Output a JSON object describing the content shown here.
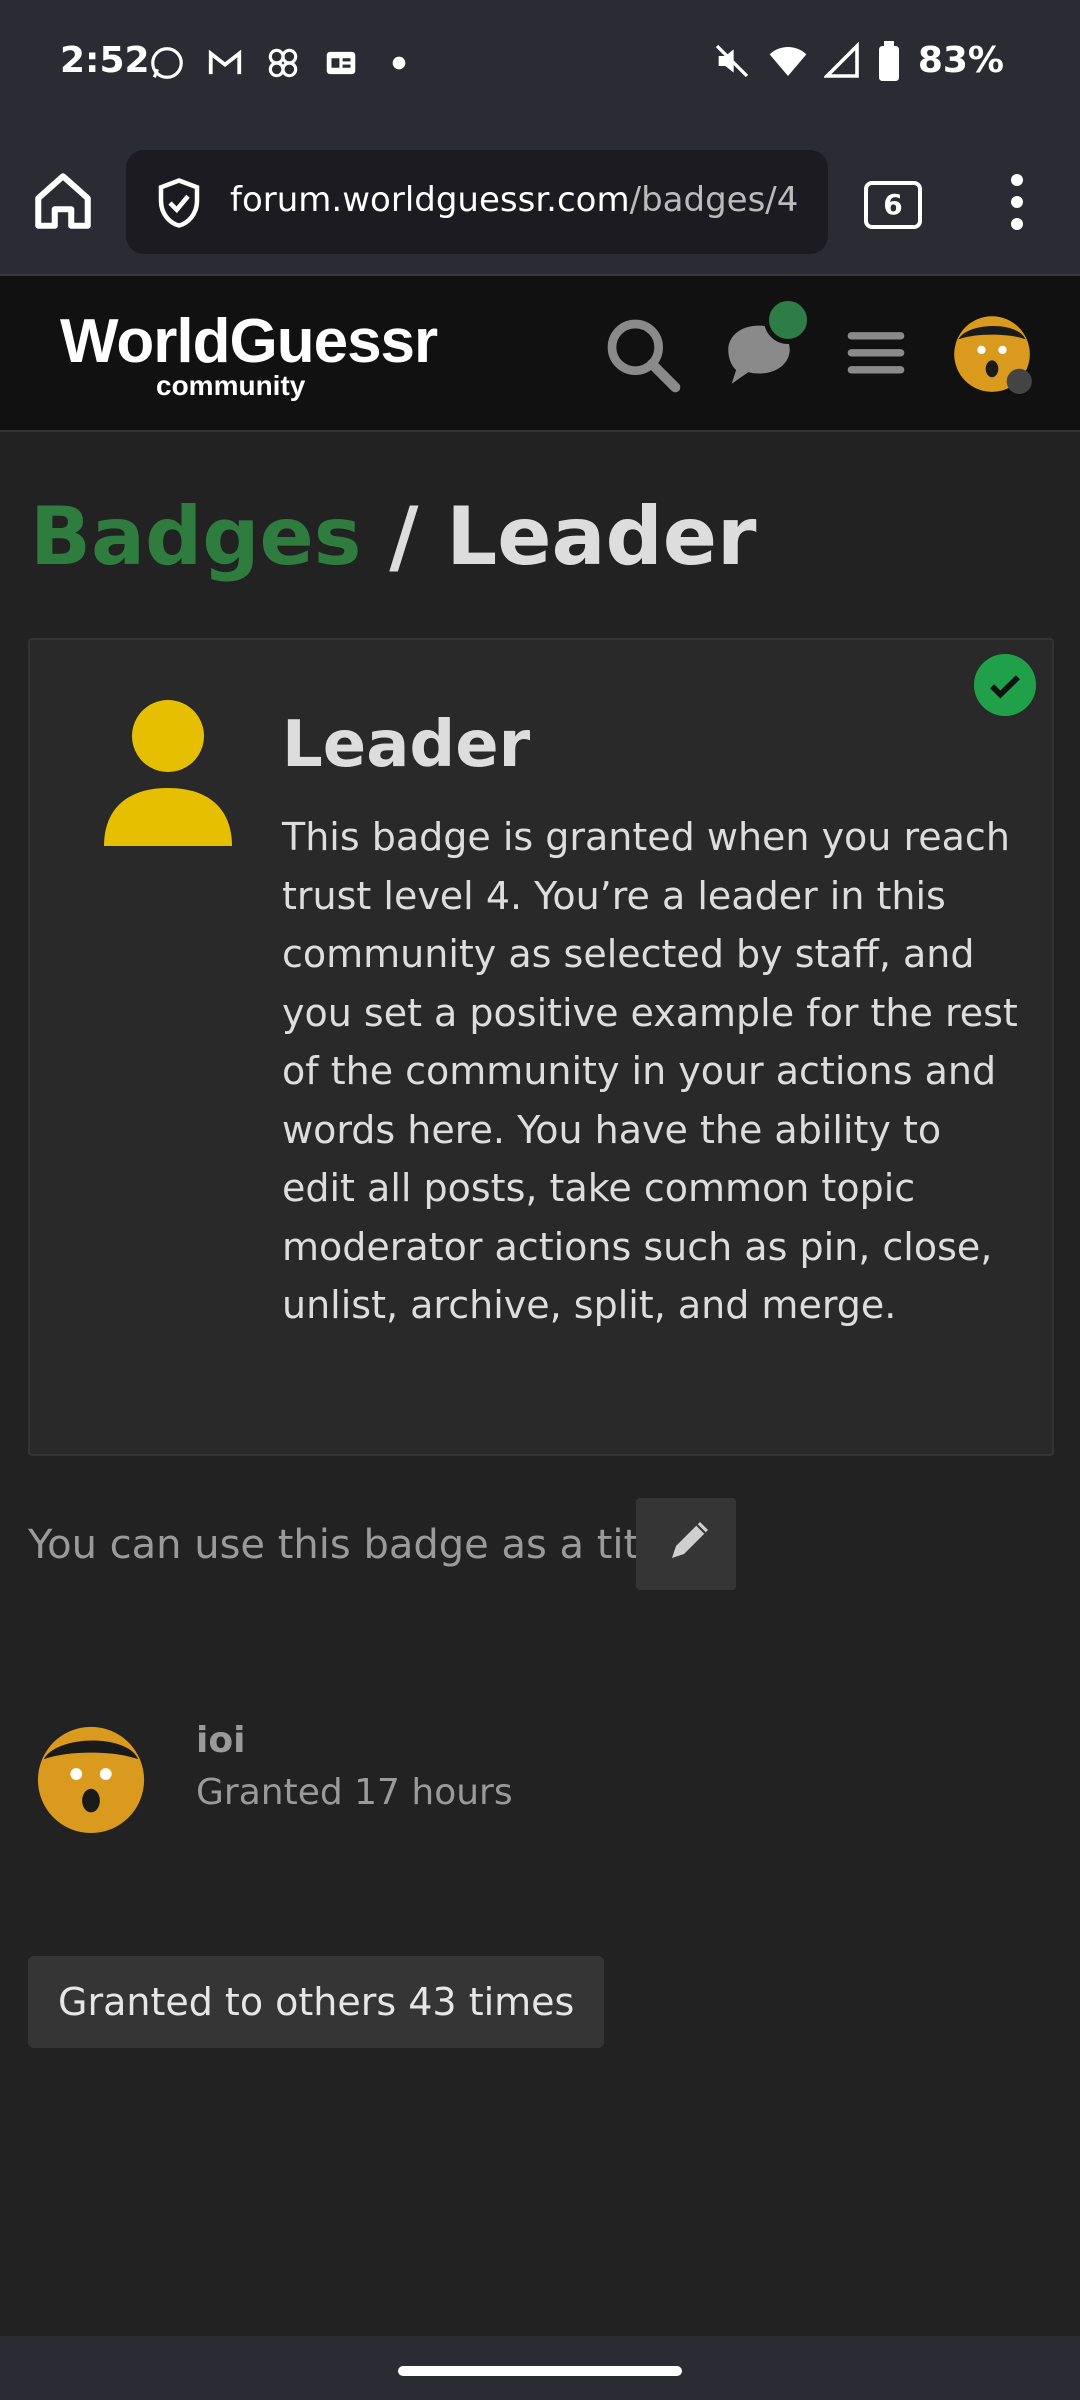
{
  "status_bar": {
    "time": "2:52",
    "battery": "83%",
    "icons": [
      "whatsapp-icon",
      "gmail-icon",
      "pinwheel-icon",
      "news-icon",
      "dot-icon",
      "mute-icon",
      "wifi-icon",
      "signal-icon",
      "battery-icon"
    ]
  },
  "browser": {
    "url_host": "forum.worldguessr.com",
    "url_path": "/badges/4",
    "tab_count": "6"
  },
  "site_header": {
    "logo_text": "WorldGuessr",
    "logo_sub": "community"
  },
  "page": {
    "breadcrumb": "Badges",
    "separator": " / ",
    "title": "Leader"
  },
  "badge": {
    "name": "Leader",
    "description": "This badge is granted when you reach trust level 4. You’re a leader in this community as selected by staff, and you set a positive example for the rest of the community in your actions and words here. You have the ability to edit all posts, take common topic moderator actions such as pin, close, unlist, archive, split, and merge.",
    "title_hint": "You can use this badge as a title"
  },
  "user": {
    "name": "ioi",
    "granted": "Granted 17 hours"
  },
  "others_button": "Granted to others 43 times",
  "colors": {
    "accent_green": "#2e7d3e",
    "check_green": "#1fa049",
    "badge_yellow": "#e6c000",
    "background": "#222222"
  }
}
